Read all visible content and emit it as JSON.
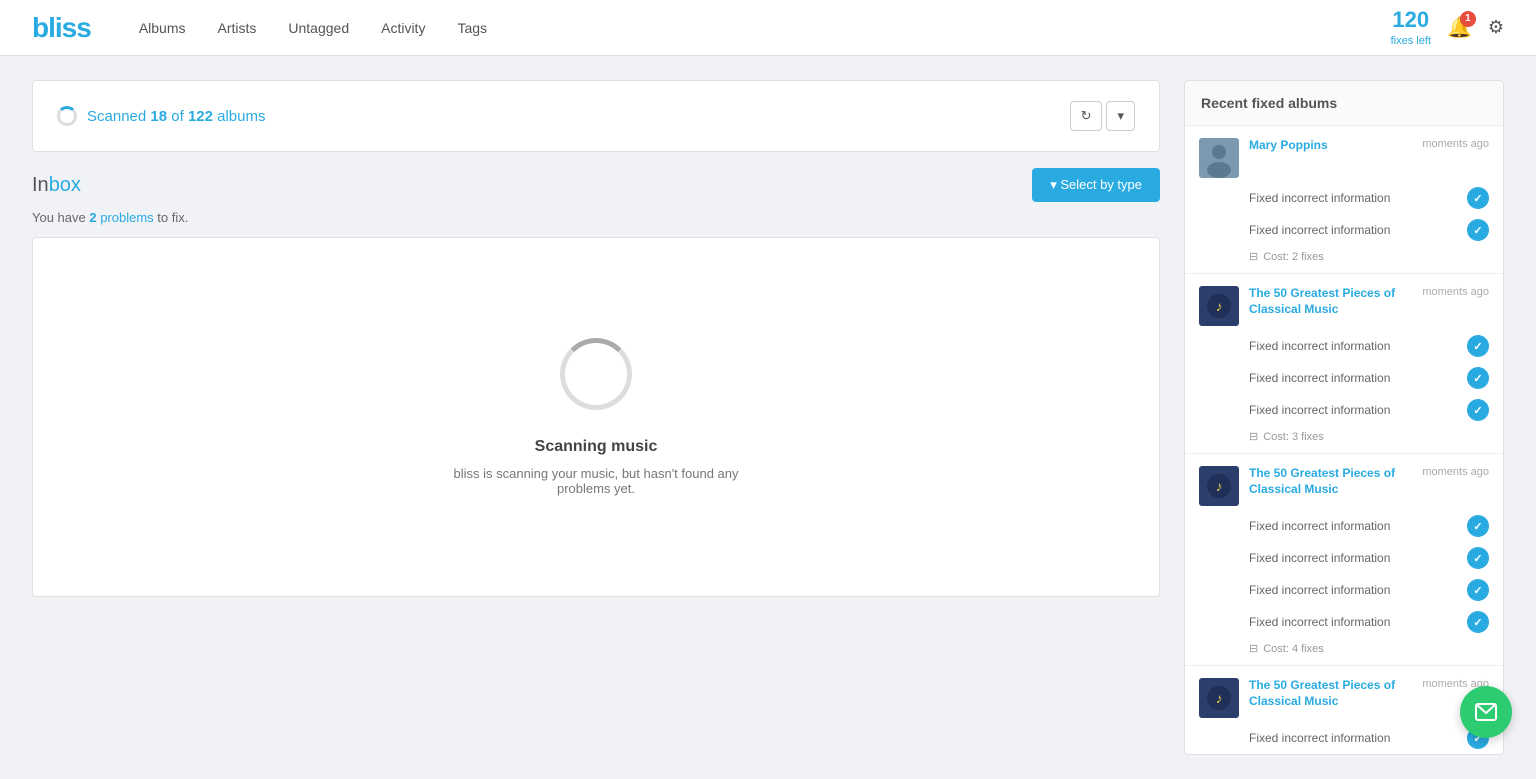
{
  "header": {
    "logo": "bliss",
    "nav": [
      "Albums",
      "Artists",
      "Untagged",
      "Activity",
      "Tags"
    ],
    "fixes_count": "120",
    "fixes_label": "fixes left",
    "bell_badge": "1"
  },
  "scan_bar": {
    "scanned": "18",
    "total": "122",
    "label_prefix": "Scanned ",
    "label_of": " of ",
    "label_suffix": " albums",
    "refresh_label": "↻",
    "dropdown_label": "▾"
  },
  "inbox": {
    "title_in": "In",
    "title_box": "box",
    "problems_text": "You have ",
    "problems_count": "2",
    "problems_label": " problems",
    "problems_suffix": " to fix.",
    "select_btn": "▾ Select by type"
  },
  "scanning": {
    "title": "Scanning music",
    "description": "bliss is scanning your music, but hasn't found any problems yet."
  },
  "sidebar": {
    "title": "Recent fixed albums",
    "albums": [
      {
        "id": "mary-poppins",
        "name": "Mary Poppins",
        "time": "moments ago",
        "fixes": [
          {
            "text": "Fixed incorrect information"
          },
          {
            "text": "Fixed incorrect information"
          }
        ],
        "cost": "Cost: 2 fixes"
      },
      {
        "id": "classical-1",
        "name": "The 50 Greatest Pieces of Classical Music",
        "time": "moments ago",
        "fixes": [
          {
            "text": "Fixed incorrect information"
          },
          {
            "text": "Fixed incorrect information"
          },
          {
            "text": "Fixed incorrect information"
          }
        ],
        "cost": "Cost: 3 fixes"
      },
      {
        "id": "classical-2",
        "name": "The 50 Greatest Pieces of Classical Music",
        "time": "moments ago",
        "fixes": [
          {
            "text": "Fixed incorrect information"
          },
          {
            "text": "Fixed incorrect information"
          },
          {
            "text": "Fixed incorrect information"
          },
          {
            "text": "Fixed incorrect information"
          }
        ],
        "cost": "Cost: 4 fixes"
      },
      {
        "id": "classical-3",
        "name": "The 50 Greatest Pieces of Classical Music",
        "time": "moments ago",
        "fixes": [
          {
            "text": "Fixed incorrect information"
          }
        ],
        "cost": ""
      }
    ]
  }
}
